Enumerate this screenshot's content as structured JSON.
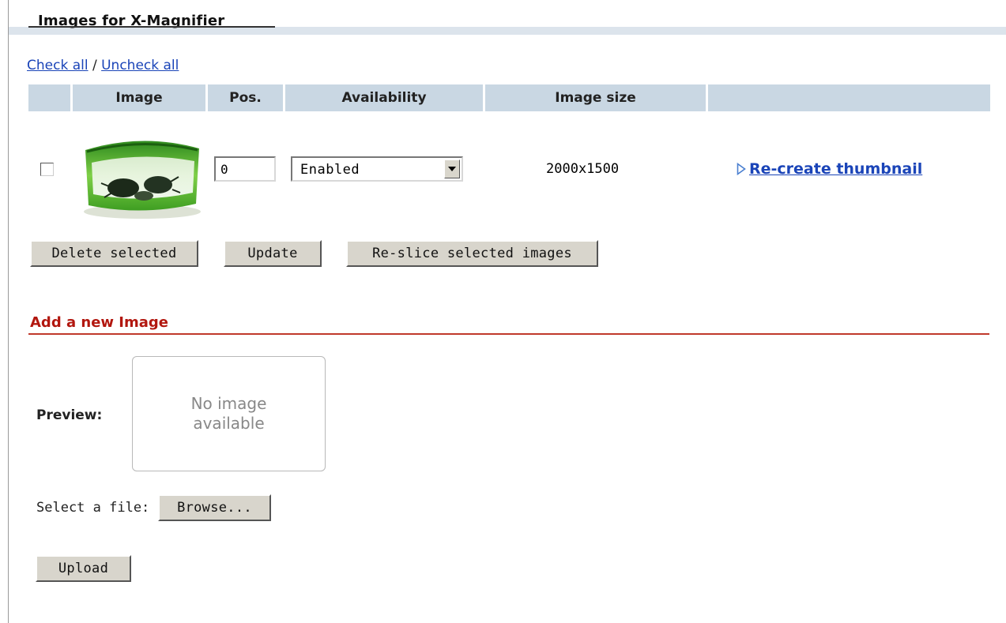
{
  "panel": {
    "title": "Images for X-Magnifier"
  },
  "links": {
    "check_all": "Check all",
    "separator": " / ",
    "uncheck_all": "Uncheck all"
  },
  "table": {
    "headers": [
      "",
      "Image",
      "Pos.",
      "Availability",
      "Image size",
      ""
    ],
    "rows": [
      {
        "checked": false,
        "position": "0",
        "availability": "Enabled",
        "image_size": "2000x1500",
        "action": "Re-create thumbnail"
      }
    ]
  },
  "buttons": {
    "delete_selected": "Delete selected",
    "update": "Update",
    "reslice": "Re-slice selected images"
  },
  "add_new": {
    "title": "Add a new Image",
    "preview_label": "Preview:",
    "no_image_line1": "No image",
    "no_image_line2": "available",
    "select_file_label": "Select a file:",
    "browse": "Browse...",
    "upload": "Upload"
  },
  "colors": {
    "header_bg": "#c9d7e3",
    "link": "#1a44b8",
    "section_title": "#b2170f",
    "button_bg": "#d8d5cc"
  },
  "icons": {
    "recreate": "triangle-right-outline-icon",
    "select_arrow": "chevron-down-icon"
  }
}
